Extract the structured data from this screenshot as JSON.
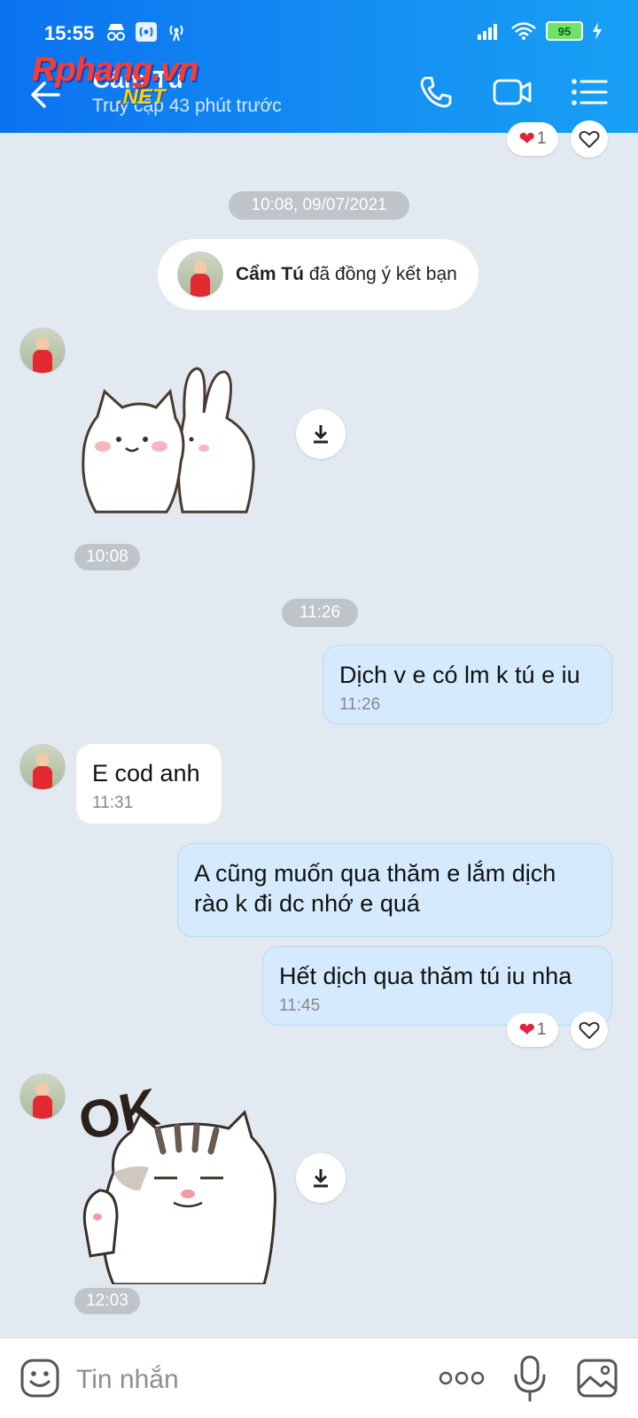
{
  "status_bar": {
    "time": "15:55",
    "battery": "95"
  },
  "header": {
    "contact_name": "Cẩm Tú",
    "last_seen": "Truy cập 43 phút trước",
    "watermark": "Rphang.vn",
    "watermark_sub": ".NET"
  },
  "chat": {
    "top_reaction_count": "1",
    "date_pill": "10:08, 09/07/2021",
    "friend_notice": {
      "name": "Cẩm Tú",
      "text": " đã đồng ý kết bạn"
    },
    "sticker1_time": "10:08",
    "time_pill_2": "11:26",
    "messages": [
      {
        "from": "me",
        "text": "Dịch v e có lm k tú e iu",
        "time": "11:26"
      },
      {
        "from": "them",
        "text": "E cod anh",
        "time": "11:31"
      },
      {
        "from": "me",
        "text": "A cũng muốn qua thăm e lắm dịch rào k đi dc nhớ e quá",
        "time": ""
      },
      {
        "from": "me",
        "text": "Hết dịch qua thăm tú iu nha",
        "time": "11:45"
      }
    ],
    "message_reaction_count": "1",
    "sticker2_text": "OK",
    "sticker2_time": "12:03"
  },
  "composer": {
    "placeholder": "Tin nhắn"
  },
  "colors": {
    "header_start": "#0b72f0",
    "header_end": "#18a0f4",
    "chat_bg": "#e2e9f1",
    "my_bubble": "#d5ebfd",
    "heart": "#e0243a"
  }
}
